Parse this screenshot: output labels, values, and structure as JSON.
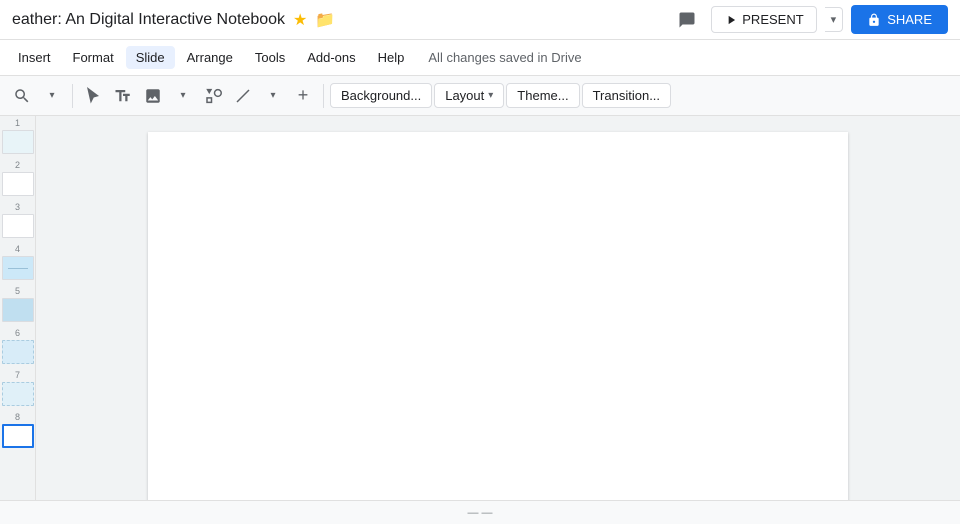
{
  "title": {
    "text": "eather: An Digital Interactive Notebook",
    "star_label": "★",
    "folder_label": "📁",
    "save_status": "All changes saved in Drive"
  },
  "header_actions": {
    "comment_icon": "💬",
    "present_label": "PRESENT",
    "present_arrow": "▾",
    "share_label": "SHARE",
    "share_icon": "👤"
  },
  "menu": {
    "items": [
      {
        "id": "insert",
        "label": "Insert"
      },
      {
        "id": "format",
        "label": "Format"
      },
      {
        "id": "slide",
        "label": "Slide"
      },
      {
        "id": "arrange",
        "label": "Arrange"
      },
      {
        "id": "tools",
        "label": "Tools"
      },
      {
        "id": "addons",
        "label": "Add-ons"
      },
      {
        "id": "help",
        "label": "Help"
      }
    ]
  },
  "toolbar": {
    "zoom_value": "⊕",
    "zoom_out": "−",
    "zoom_in": "+",
    "select_icon": "↖",
    "text_box_icon": "T",
    "image_icon": "🖼",
    "shapes_icon": "⬡",
    "line_icon": "╱",
    "plus_icon": "+",
    "background_label": "Background...",
    "layout_label": "Layout",
    "layout_arrow": "▾",
    "theme_label": "Theme...",
    "transition_label": "Transition..."
  },
  "slides": [
    {
      "id": 1,
      "active": false,
      "bg": "#e8f4f8"
    },
    {
      "id": 2,
      "active": false,
      "bg": "#ffffff"
    },
    {
      "id": 3,
      "active": false,
      "bg": "#ffffff"
    },
    {
      "id": 4,
      "active": false,
      "bg": "#d0e8f0"
    },
    {
      "id": 5,
      "active": false,
      "bg": "#c8e0f0"
    },
    {
      "id": 6,
      "active": false,
      "bg": "#d8ecf8"
    },
    {
      "id": 7,
      "active": false,
      "bg": "#e0f0f8"
    },
    {
      "id": 8,
      "active": true,
      "bg": "#ffffff"
    }
  ],
  "bottom_bar": {
    "page_info": "— —"
  },
  "colors": {
    "accent": "#1a73e8",
    "slide_active_border": "#1a73e8"
  }
}
